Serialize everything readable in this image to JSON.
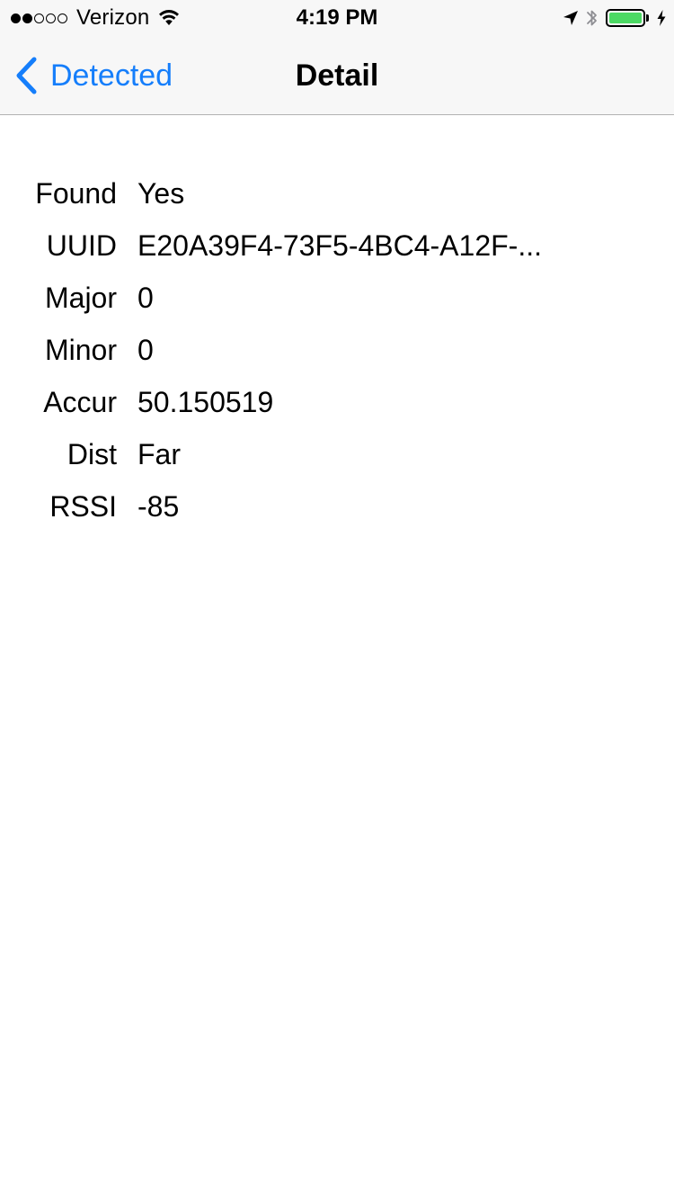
{
  "status_bar": {
    "carrier": "Verizon",
    "time": "4:19 PM",
    "signal_dots_filled": 2,
    "signal_dots_total": 5,
    "battery_level": 1.0,
    "battery_color": "#4cd964",
    "icons": [
      "wifi-icon",
      "location-arrow-icon",
      "bluetooth-icon",
      "battery-icon",
      "charging-bolt-icon"
    ]
  },
  "nav": {
    "back_label": "Detected",
    "title": "Detail",
    "accent_color": "#157efb"
  },
  "details": [
    {
      "label": "Found",
      "value": "Yes"
    },
    {
      "label": "UUID",
      "value": "E20A39F4-73F5-4BC4-A12F-..."
    },
    {
      "label": "Major",
      "value": "0"
    },
    {
      "label": "Minor",
      "value": "0"
    },
    {
      "label": "Accur",
      "value": "50.150519"
    },
    {
      "label": "Dist",
      "value": "Far"
    },
    {
      "label": "RSSI",
      "value": "-85"
    }
  ]
}
